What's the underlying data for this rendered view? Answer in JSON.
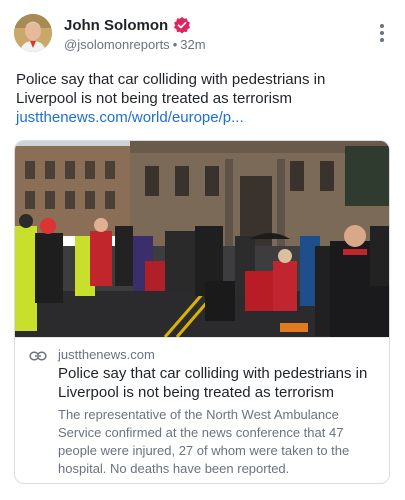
{
  "author": {
    "name": "John Solomon",
    "handle": "@jsolomonreports",
    "time": "32m"
  },
  "post": {
    "text": "Police say that car colliding with pedestrians in Liverpool is not being treated as terrorism",
    "link": "justthenews.com/world/europe/p..."
  },
  "card": {
    "domain": "justthenews.com",
    "title": "Police say that car colliding with pedestrians in Liverpool is not being treated as terrorism",
    "description": "The representative of the North West Ambulance Service confirmed at the news conference that 47 people were injured, 27 of whom were taken to the hospital. No deaths have been reported."
  },
  "colors": {
    "verified_badge": "#e0245e",
    "link": "#1d6fd6",
    "muted": "#6b7280"
  },
  "icons": {
    "verified": "verified-badge-icon",
    "more": "more-vertical-icon",
    "link": "link-chain-icon"
  }
}
